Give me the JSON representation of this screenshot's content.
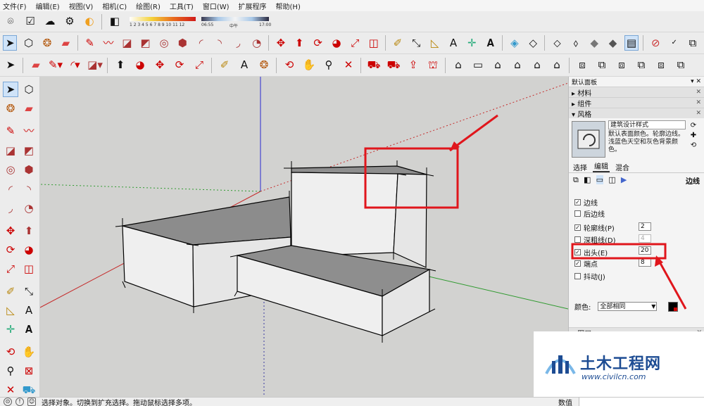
{
  "menu": [
    "文件(F)",
    "编辑(E)",
    "视图(V)",
    "相机(C)",
    "绘图(R)",
    "工具(T)",
    "窗口(W)",
    "扩展程序",
    "帮助(H)"
  ],
  "shadow": {
    "months": "1 2 3 4 5 6 7 8 9 10 11 12",
    "time_start": "06:55",
    "time_mid": "中午",
    "time_end": "17:00"
  },
  "panel": {
    "title": "默认面板",
    "sections": [
      "材料",
      "组件",
      "风格"
    ],
    "style_name": "建筑设计样式",
    "style_desc": "默认表面颜色。轮廓边线。浅蓝色天空和灰色背景颜色。",
    "tabs": [
      "选择",
      "编辑",
      "混合"
    ],
    "edit_label": "边线",
    "options": [
      {
        "label": "边线",
        "checked": true,
        "value": null
      },
      {
        "label": "后边线",
        "checked": false,
        "value": null
      },
      {
        "label": "轮廓线(P)",
        "checked": true,
        "value": "2"
      },
      {
        "label": "深粗线(D)",
        "checked": false,
        "value": "4"
      },
      {
        "label": "出头(E)",
        "checked": true,
        "value": "20"
      },
      {
        "label": "端点",
        "checked": true,
        "value": "8"
      },
      {
        "label": "抖动(J)",
        "checked": false,
        "value": null
      }
    ],
    "color_label": "颜色:",
    "color_value": "全部相同",
    "bottom_sections": [
      "图层",
      "",
      "",
      ""
    ]
  },
  "status": {
    "text": "选择对象。切换到扩充选择。拖动鼠标选择多项。",
    "measure_label": "数值"
  },
  "watermark": {
    "title": "土木工程网",
    "url": "www.civilcn.com"
  },
  "colors": {
    "annotation": "#e0161c",
    "axis_red": "#c52b2b",
    "axis_green": "#2f9a2f",
    "axis_blue": "#2a2ad0",
    "brand": "#1d4c93"
  }
}
